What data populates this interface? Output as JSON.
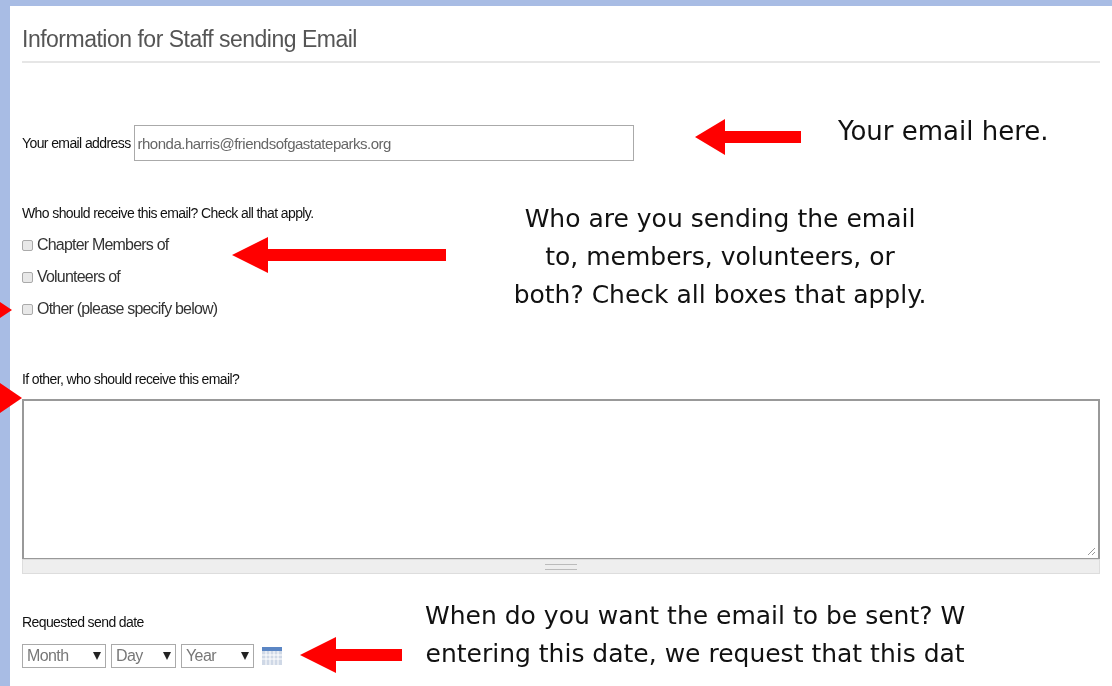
{
  "heading": "Information for Staff sending Email",
  "email": {
    "label": "Your email address",
    "value": "rhonda.harris@friendsofgastateparks.org"
  },
  "recipients": {
    "question": "Who should receive this email? Check all that apply.",
    "options": [
      {
        "label": "Chapter Members of",
        "checked": false
      },
      {
        "label": "Volunteers of",
        "checked": false
      },
      {
        "label": "Other (please specify below)",
        "checked": false
      }
    ]
  },
  "other": {
    "label": "If other, who should receive this email?"
  },
  "send_date": {
    "label": "Requested send date",
    "selects": [
      "Month",
      "Day",
      "Year"
    ]
  },
  "annotations": [
    {
      "kind": "email",
      "text": "Your email here."
    },
    {
      "kind": "recipients",
      "text": "Who are you sending the email\nto, members, volunteers, or\nboth? Check all boxes that apply."
    },
    {
      "kind": "date",
      "text": "When do you want the email to be sent? W\nentering this date, we request that this dat"
    }
  ]
}
